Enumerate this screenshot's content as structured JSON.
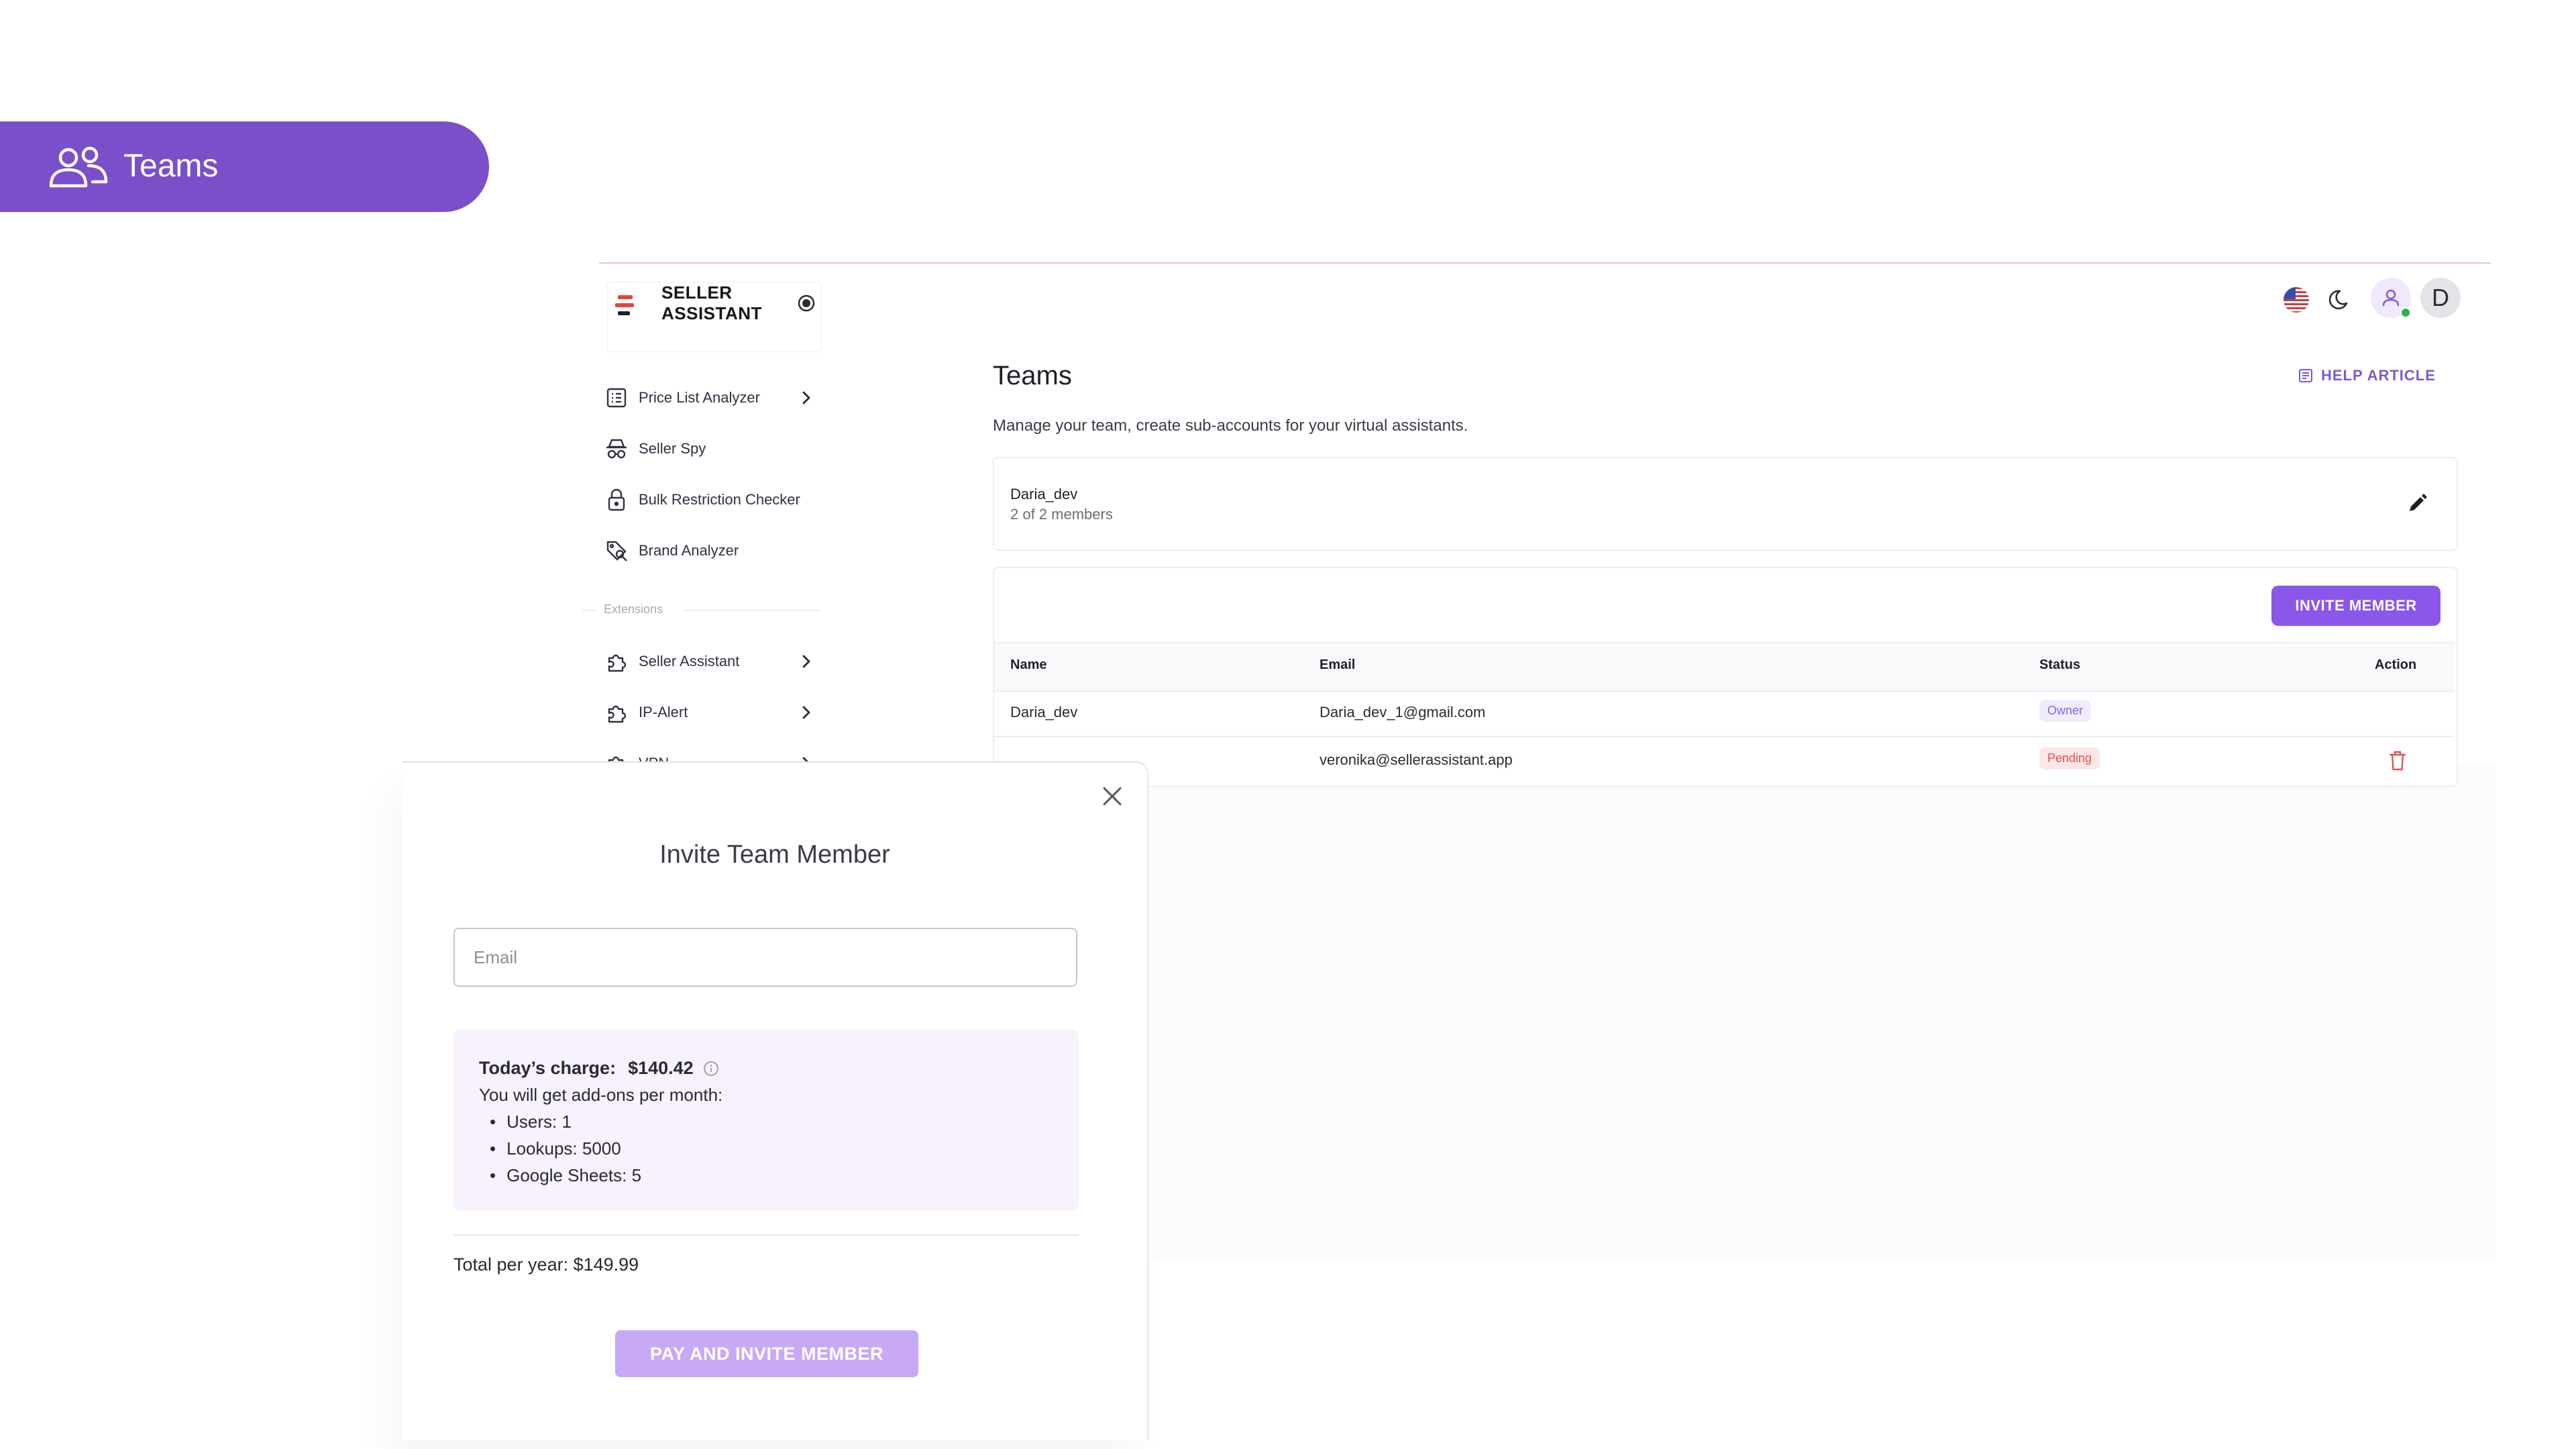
{
  "banner": {
    "title": "Teams",
    "icon": "users-icon"
  },
  "app": {
    "logo": {
      "line1": "SELLER",
      "line2": "ASSISTANT",
      "icon": "seller-assistant-logo"
    },
    "sidebar": {
      "tools": [
        {
          "label": "Price List Analyzer",
          "icon": "table-list-icon",
          "has_chevron": true
        },
        {
          "label": "Seller Spy",
          "icon": "spy-icon",
          "has_chevron": false
        },
        {
          "label": "Bulk Restriction Checker",
          "icon": "lock-icon",
          "has_chevron": false
        },
        {
          "label": "Brand Analyzer",
          "icon": "tag-search-icon",
          "has_chevron": false
        }
      ],
      "extensions_label": "Extensions",
      "extensions": [
        {
          "label": "Seller Assistant",
          "icon": "puzzle-icon",
          "has_chevron": true
        },
        {
          "label": "IP-Alert",
          "icon": "puzzle-icon",
          "has_chevron": true
        },
        {
          "label": "VPN",
          "icon": "puzzle-icon",
          "has_chevron": true
        }
      ]
    },
    "header": {
      "avatar_letter": "D",
      "language_icon": "us-flag-icon",
      "theme_icon": "moon-icon",
      "user_icon": "user-icon",
      "online_color": "#29b34a"
    },
    "page": {
      "title": "Teams",
      "help_label": "HELP ARTICLE",
      "subtitle": "Manage your team, create sub-accounts for your virtual assistants.",
      "team": {
        "name": "Daria_dev",
        "members": "2 of 2 members"
      },
      "invite_label": "INVITE MEMBER",
      "table": {
        "headers": {
          "name": "Name",
          "email": "Email",
          "status": "Status",
          "action": "Action"
        },
        "rows": [
          {
            "name": "Daria_dev",
            "email": "Daria_dev_1@gmail.com",
            "status": "Owner"
          },
          {
            "name": "",
            "email": "veronika@sellerassistant.app",
            "status": "Pending"
          }
        ]
      }
    },
    "accent_color": "#8b57ea"
  },
  "modal": {
    "title": "Invite Team Member",
    "email_placeholder": "Email",
    "email_value": "",
    "charge_label": "Today’s charge:",
    "charge_amount": "$140.42",
    "addons_intro": "You will get add-ons per month:",
    "addons": [
      "Users: 1",
      "Lookups: 5000",
      "Google Sheets: 5"
    ],
    "total": "Total per year: $149.99",
    "pay_label": "PAY AND INVITE MEMBER"
  }
}
